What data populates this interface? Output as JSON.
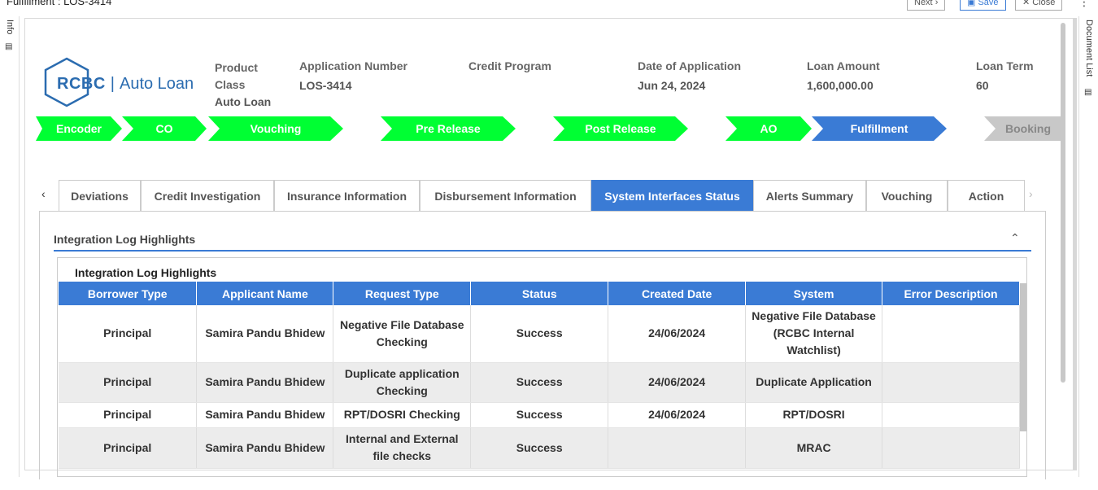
{
  "window": {
    "title": "Fulfillment : LOS-3414",
    "buttons": {
      "next": "Next",
      "save": "Save",
      "close": "Close"
    }
  },
  "rails": {
    "left": "Info",
    "right": "Document List"
  },
  "brand": {
    "rcbc": "RCBC",
    "product": "Auto Loan"
  },
  "header": {
    "product_class_label": "Product Class",
    "product_class_value": "Auto Loan",
    "application_number_label": "Application Number",
    "application_number_value": "LOS-3414",
    "credit_program_label": "Credit Program",
    "credit_program_value": "",
    "date_label": "Date of Application",
    "date_value": "Jun 24, 2024",
    "loan_amount_label": "Loan Amount",
    "loan_amount_value": "1,600,000.00",
    "loan_term_label": "Loan Term",
    "loan_term_value": "60"
  },
  "stages": [
    {
      "label": "Encoder",
      "state": "done"
    },
    {
      "label": "CO",
      "state": "done"
    },
    {
      "label": "Vouching",
      "state": "done"
    },
    {
      "label": "Pre Release",
      "state": "done"
    },
    {
      "label": "Post Release",
      "state": "done"
    },
    {
      "label": "AO",
      "state": "done"
    },
    {
      "label": "Fulfillment",
      "state": "current"
    },
    {
      "label": "Booking",
      "state": "pending"
    }
  ],
  "stage_colors": {
    "done": "#00ff33",
    "current": "#3a7bd5",
    "pending": "#c8c8c8"
  },
  "tabs": [
    {
      "label": "Deviations"
    },
    {
      "label": "Credit Investigation"
    },
    {
      "label": "Insurance Information"
    },
    {
      "label": "Disbursement Information"
    },
    {
      "label": "System Interfaces Status",
      "active": true
    },
    {
      "label": "Alerts Summary"
    },
    {
      "label": "Vouching"
    },
    {
      "label": "Action"
    }
  ],
  "section": {
    "title": "Integration Log Highlights"
  },
  "table": {
    "title": "Integration Log Highlights",
    "columns": [
      "Borrower Type",
      "Applicant Name",
      "Request Type",
      "Status",
      "Created Date",
      "System",
      "Error Description"
    ],
    "rows": [
      [
        "Principal",
        "Samira Pandu Bhidew",
        "Negative File Database Checking",
        "Success",
        "24/06/2024",
        "Negative File Database (RCBC Internal Watchlist)",
        ""
      ],
      [
        "Principal",
        "Samira Pandu Bhidew",
        "Duplicate application Checking",
        "Success",
        "24/06/2024",
        "Duplicate Application",
        ""
      ],
      [
        "Principal",
        "Samira Pandu Bhidew",
        "RPT/DOSRI Checking",
        "Success",
        "24/06/2024",
        "RPT/DOSRI",
        ""
      ],
      [
        "Principal",
        "Samira Pandu Bhidew",
        "Internal and External file checks",
        "Success",
        "",
        "MRAC",
        ""
      ]
    ]
  },
  "accent_color": "#3a7bd5"
}
